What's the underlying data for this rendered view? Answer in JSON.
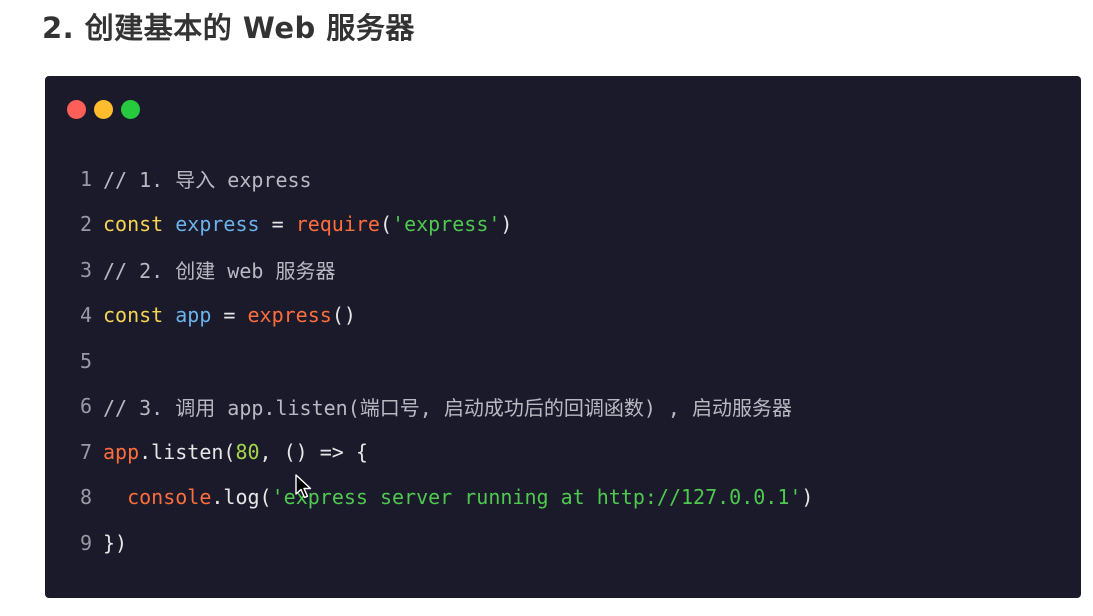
{
  "heading": "2. 创建基本的 Web 服务器",
  "window_controls": {
    "close_color": "#ff5f56",
    "minimize_color": "#ffbd2e",
    "maximize_color": "#27c93f"
  },
  "code": {
    "language": "javascript",
    "lines": [
      {
        "number": "1",
        "tokens": [
          {
            "type": "cmt",
            "text": "// 1. 导入 express"
          }
        ]
      },
      {
        "number": "2",
        "tokens": [
          {
            "type": "kw",
            "text": "const"
          },
          {
            "type": "txt",
            "text": " "
          },
          {
            "type": "var",
            "text": "express"
          },
          {
            "type": "op",
            "text": " = "
          },
          {
            "type": "fn",
            "text": "require"
          },
          {
            "type": "paren",
            "text": "("
          },
          {
            "type": "str",
            "text": "'express'"
          },
          {
            "type": "paren",
            "text": ")"
          }
        ]
      },
      {
        "number": "3",
        "tokens": [
          {
            "type": "cmt",
            "text": "// 2. 创建 web 服务器"
          }
        ]
      },
      {
        "number": "4",
        "tokens": [
          {
            "type": "kw",
            "text": "const"
          },
          {
            "type": "txt",
            "text": " "
          },
          {
            "type": "var",
            "text": "app"
          },
          {
            "type": "op",
            "text": " = "
          },
          {
            "type": "fn",
            "text": "express"
          },
          {
            "type": "paren",
            "text": "()"
          }
        ]
      },
      {
        "number": "5",
        "tokens": []
      },
      {
        "number": "6",
        "tokens": [
          {
            "type": "cmt",
            "text": "// 3. 调用 app.listen(端口号, 启动成功后的回调函数) , 启动服务器"
          }
        ]
      },
      {
        "number": "7",
        "tokens": [
          {
            "type": "fn",
            "text": "app"
          },
          {
            "type": "txt",
            "text": ".listen("
          },
          {
            "type": "num",
            "text": "80"
          },
          {
            "type": "txt",
            "text": ", () => {"
          }
        ]
      },
      {
        "number": "8",
        "tokens": [
          {
            "type": "txt",
            "text": "  "
          },
          {
            "type": "fn",
            "text": "console"
          },
          {
            "type": "txt",
            "text": ".log("
          },
          {
            "type": "str",
            "text": "'express server running at http://127.0.0.1'"
          },
          {
            "type": "paren",
            "text": ")"
          }
        ]
      },
      {
        "number": "9",
        "tokens": [
          {
            "type": "txt",
            "text": "})"
          }
        ]
      }
    ]
  },
  "icons": {
    "cursor": "mouse-pointer-icon"
  }
}
